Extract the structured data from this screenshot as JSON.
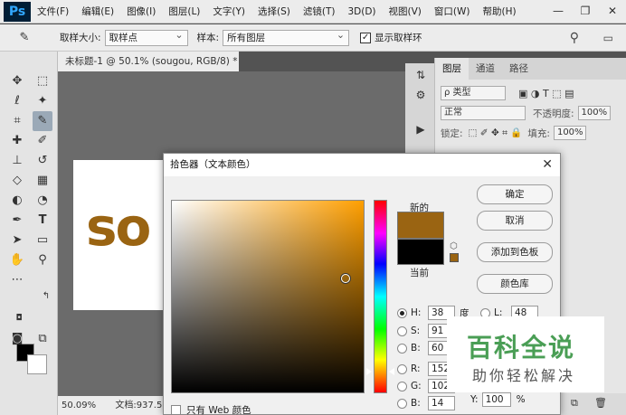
{
  "app": {
    "logo": "Ps"
  },
  "menu": [
    "文件(F)",
    "编辑(E)",
    "图像(I)",
    "图层(L)",
    "文字(Y)",
    "选择(S)",
    "滤镜(T)",
    "3D(D)",
    "视图(V)",
    "窗口(W)",
    "帮助(H)"
  ],
  "window_controls": {
    "minimize": "—",
    "restore": "❐",
    "close": "✕"
  },
  "options": {
    "sample_size_label": "取样大小:",
    "sample_size_value": "取样点",
    "sample_label": "样本:",
    "sample_value": "所有图层",
    "show_ring_label": "显示取样环"
  },
  "document": {
    "tab_title": "未标题-1 @ 50.1% (sougou, RGB/8) *",
    "canvas_text": "so",
    "zoom": "50.09%",
    "doc_info": "文档:937.5"
  },
  "layers_panel": {
    "tabs": [
      "图层",
      "通道",
      "路径"
    ],
    "filter_label": "ρ 类型",
    "blend_mode": "正常",
    "opacity_label": "不透明度:",
    "opacity_value": "100%",
    "lock_label": "锁定:",
    "fill_label": "填充:",
    "fill_value": "100%"
  },
  "color_picker": {
    "title": "拾色器（文本颜色）",
    "new_label": "新的",
    "current_label": "当前",
    "new_color": "#9a6412",
    "current_color": "#000000",
    "buttons": {
      "ok": "确定",
      "cancel": "取消",
      "add_to_swatches": "添加到色板",
      "color_libraries": "颜色库"
    },
    "hsb": {
      "h_label": "H:",
      "h": "38",
      "h_unit": "度",
      "s_label": "S:",
      "s": "91",
      "b_label": "B:",
      "b": "60"
    },
    "rgb": {
      "r_label": "R:",
      "r": "152",
      "g_label": "G:",
      "g": "102",
      "b_label": "B:",
      "b": "14"
    },
    "lab": {
      "l_label": "L:",
      "l": "48"
    },
    "web_only_label": "只有 Web 颜色",
    "y_label": "Y:",
    "y_value": "100",
    "y_unit": "%"
  },
  "watermark": {
    "top": "百科全说",
    "bottom": "助你轻松解决"
  }
}
